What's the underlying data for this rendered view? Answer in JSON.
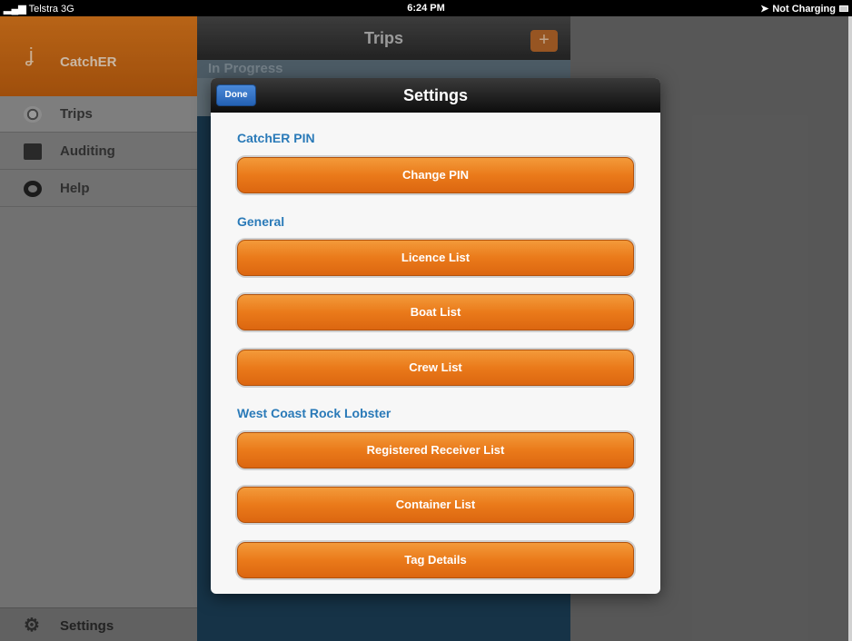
{
  "status_bar": {
    "carrier": "Telstra",
    "network": "3G",
    "time": "6:24 PM",
    "charging": "Not Charging"
  },
  "sidebar": {
    "brand": "CatchER",
    "items": [
      {
        "label": "Trips",
        "icon": "globe-icon",
        "active": true
      },
      {
        "label": "Auditing",
        "icon": "ledger-icon",
        "active": false
      },
      {
        "label": "Help",
        "icon": "lifebuoy-icon",
        "active": false
      }
    ],
    "settings_label": "Settings"
  },
  "trips_pane": {
    "title": "Trips",
    "add_label": "+",
    "section": "In Progress"
  },
  "settings_modal": {
    "title": "Settings",
    "done_label": "Done",
    "groups": [
      {
        "title": "CatchER PIN",
        "buttons": [
          "Change PIN"
        ]
      },
      {
        "title": "General",
        "buttons": [
          "Licence List",
          "Boat List",
          "Crew List"
        ]
      },
      {
        "title": "West Coast Rock Lobster",
        "buttons": [
          "Registered Receiver List",
          "Container List",
          "Tag Details"
        ]
      }
    ]
  },
  "colors": {
    "accent_orange": "#e8781a",
    "group_title_blue": "#2a7ab8",
    "done_blue": "#2f6fc4"
  }
}
